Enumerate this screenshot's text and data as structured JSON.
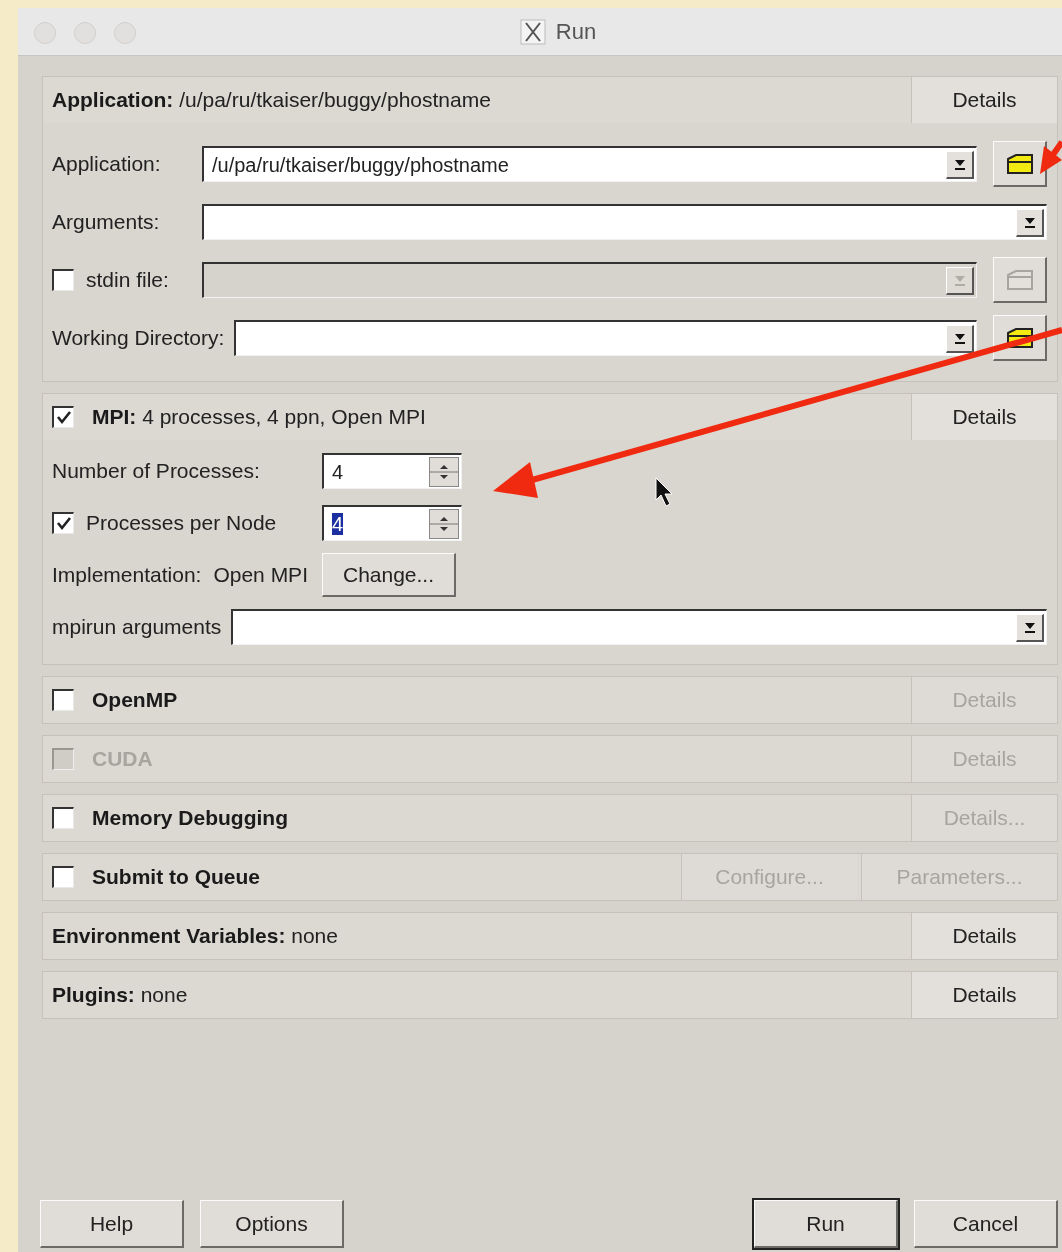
{
  "window": {
    "title": "Run"
  },
  "sections": [
    {
      "title": "Application:",
      "summary": "/u/pa/ru/tkaiser/buggy/phostname",
      "buttons": [
        {
          "label": "Details",
          "disabled": false
        }
      ],
      "rows": [
        {
          "kind": "combo",
          "label": "Application:",
          "value": "/u/pa/ru/tkaiser/buggy/phostname",
          "disabled": false,
          "browse": {
            "disabled": false
          }
        },
        {
          "kind": "combo",
          "label": "Arguments:",
          "disabled": false
        },
        {
          "kind": "combo",
          "label": "stdin file:",
          "disabled": true,
          "checkbox": {
            "checked": false,
            "disabled": false
          },
          "browse": {
            "disabled": true
          }
        },
        {
          "kind": "combo",
          "label": "Working Directory:",
          "disabled": false,
          "browse": {
            "disabled": false
          }
        }
      ]
    },
    {
      "title": "MPI:",
      "summary": "4 processes, 4 ppn, Open MPI",
      "checkbox": {
        "checked": true,
        "disabled": false
      },
      "buttons": [
        {
          "label": "Details",
          "disabled": false
        }
      ],
      "rows": [
        {
          "kind": "spin",
          "label": "Number of Processes:",
          "value": "4",
          "value_selected": false
        },
        {
          "kind": "spin",
          "label": "Processes per Node",
          "value": "4",
          "value_selected": true,
          "checkbox": {
            "checked": true,
            "disabled": false
          }
        },
        {
          "kind": "info",
          "label": "Implementation:",
          "value": "Open MPI",
          "button": "Change..."
        },
        {
          "kind": "combo",
          "label": "mpirun arguments",
          "disabled": false
        }
      ]
    },
    {
      "title": "OpenMP",
      "checkbox": {
        "checked": false,
        "disabled": false
      },
      "buttons": [
        {
          "label": "Details",
          "disabled": true
        }
      ]
    },
    {
      "title": "CUDA",
      "checkbox": {
        "checked": false,
        "disabled": true
      },
      "buttons": [
        {
          "label": "Details",
          "disabled": true
        }
      ]
    },
    {
      "title": "Memory Debugging",
      "checkbox": {
        "checked": false,
        "disabled": false
      },
      "buttons": [
        {
          "label": "Details...",
          "disabled": true
        }
      ]
    },
    {
      "title": "Submit to Queue",
      "checkbox": {
        "checked": false,
        "disabled": false
      },
      "buttons": [
        {
          "label": "Configure...",
          "disabled": true
        },
        {
          "label": "Parameters...",
          "disabled": true
        }
      ]
    },
    {
      "title": "Environment Variables:",
      "summary": "none",
      "buttons": [
        {
          "label": "Details",
          "disabled": false
        }
      ]
    },
    {
      "title": "Plugins:",
      "summary": "none",
      "buttons": [
        {
          "label": "Details",
          "disabled": false
        }
      ]
    }
  ],
  "footer": {
    "left": [
      {
        "label": "Help",
        "default": false
      },
      {
        "label": "Options",
        "default": false
      }
    ],
    "right": [
      {
        "label": "Run",
        "default": true
      },
      {
        "label": "Cancel",
        "default": false
      }
    ]
  }
}
